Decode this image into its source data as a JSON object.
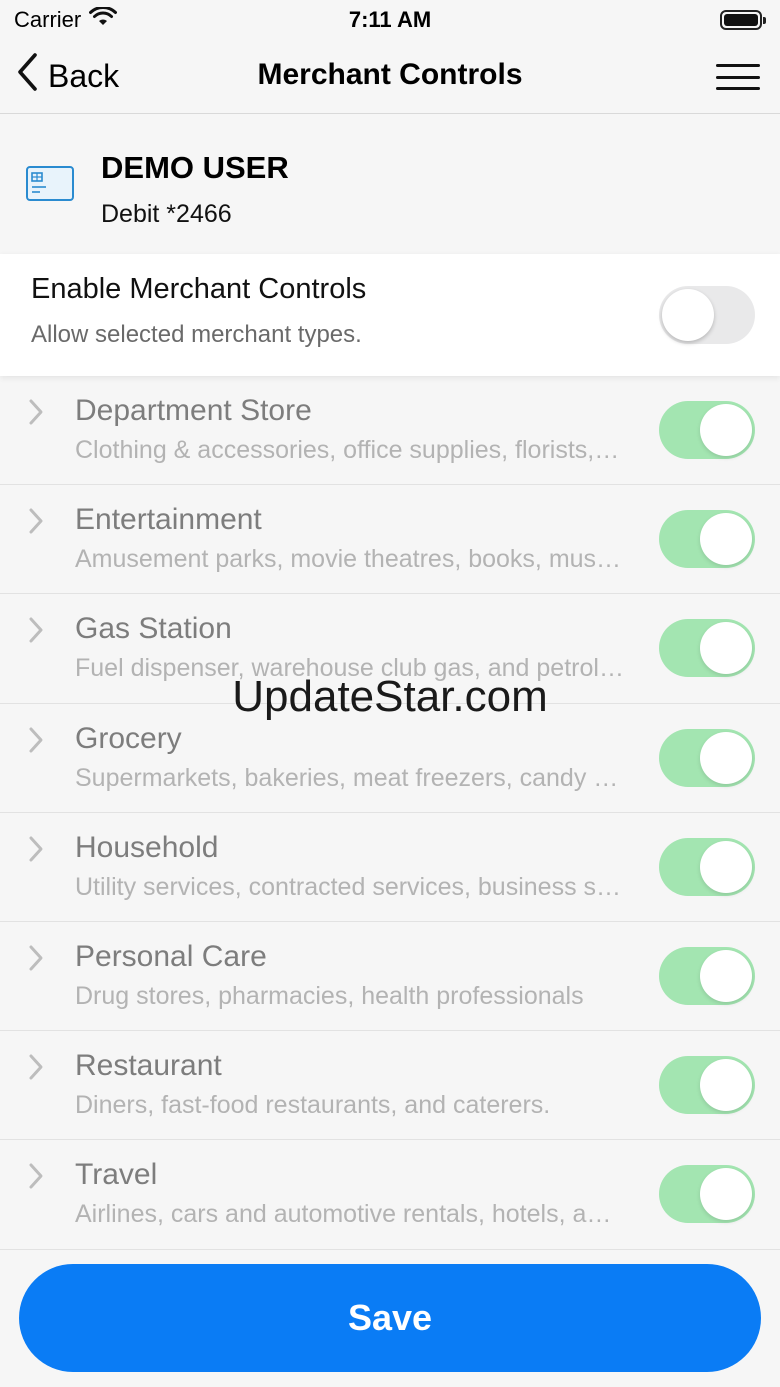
{
  "status_bar": {
    "carrier": "Carrier",
    "time": "7:11 AM"
  },
  "nav": {
    "back_label": "Back",
    "title": "Merchant Controls"
  },
  "account": {
    "name": "DEMO USER",
    "card": "Debit *2466"
  },
  "enable": {
    "title": "Enable Merchant Controls",
    "subtitle": "Allow selected merchant types.",
    "enabled": false
  },
  "merchants": [
    {
      "title": "Department Store",
      "desc": "Clothing & accessories, office supplies, florists, and more",
      "enabled": true
    },
    {
      "title": "Entertainment",
      "desc": "Amusement parks, movie theatres, books, music, and more",
      "enabled": true
    },
    {
      "title": "Gas Station",
      "desc": "Fuel dispenser, warehouse club gas, and petroleum",
      "enabled": true
    },
    {
      "title": "Grocery",
      "desc": "Supermarkets, bakeries, meat freezers, candy stores",
      "enabled": true
    },
    {
      "title": "Household",
      "desc": "Utility services, contracted services, business services",
      "enabled": true
    },
    {
      "title": "Personal Care",
      "desc": "Drug stores, pharmacies, health professionals",
      "enabled": true
    },
    {
      "title": "Restaurant",
      "desc": "Diners, fast-food restaurants, and caterers.",
      "enabled": true
    },
    {
      "title": "Travel",
      "desc": "Airlines, cars and automotive rentals, hotels, and more",
      "enabled": true
    }
  ],
  "watermark": "UpdateStar.com",
  "save_label": "Save",
  "colors": {
    "accent": "#0a7cf5",
    "toggle_on": "#a3e5b1",
    "toggle_off": "#e9e9ea",
    "card_icon": "#2a8bd0"
  }
}
